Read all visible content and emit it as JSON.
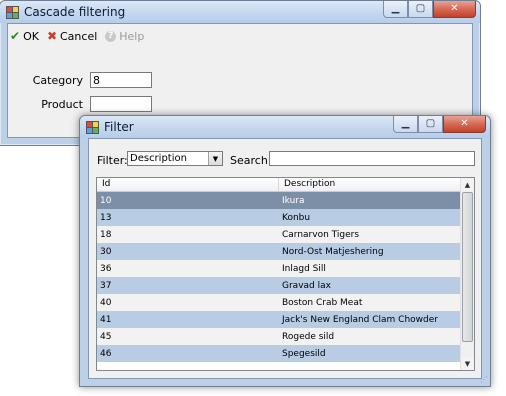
{
  "main_window": {
    "title": "Cascade filtering",
    "toolbar": {
      "ok": "OK",
      "cancel": "Cancel",
      "help": "Help"
    },
    "category_label": "Category",
    "category_value": "8",
    "product_label": "Product",
    "product_value": ""
  },
  "filter_window": {
    "title": "Filter",
    "filter_label": "Filter:",
    "filter_selected": "Description",
    "search_label": "Search:",
    "search_value": "",
    "columns": [
      "Id",
      "Description"
    ],
    "rows": [
      {
        "id": "10",
        "description": "Ikura"
      },
      {
        "id": "13",
        "description": "Konbu"
      },
      {
        "id": "18",
        "description": "Carnarvon Tigers"
      },
      {
        "id": "30",
        "description": "Nord-Ost Matjeshering"
      },
      {
        "id": "36",
        "description": "Inlagd Sill"
      },
      {
        "id": "37",
        "description": "Gravad lax"
      },
      {
        "id": "40",
        "description": "Boston Crab Meat"
      },
      {
        "id": "41",
        "description": "Jack's New England Clam Chowder"
      },
      {
        "id": "45",
        "description": "Rogede sild"
      },
      {
        "id": "46",
        "description": "Spegesild"
      }
    ],
    "selected_row": 0
  },
  "colors": {
    "row_selected": "#7d8fa6",
    "row_alt": "#b8cce4",
    "row_normal": "#f2f2f2"
  },
  "icons": {
    "caption_minimize": "minimize-icon",
    "caption_maximize": "maximize-icon",
    "caption_close": "close-icon",
    "ok": "checkmark-icon",
    "cancel": "x-icon",
    "help": "help-icon"
  }
}
